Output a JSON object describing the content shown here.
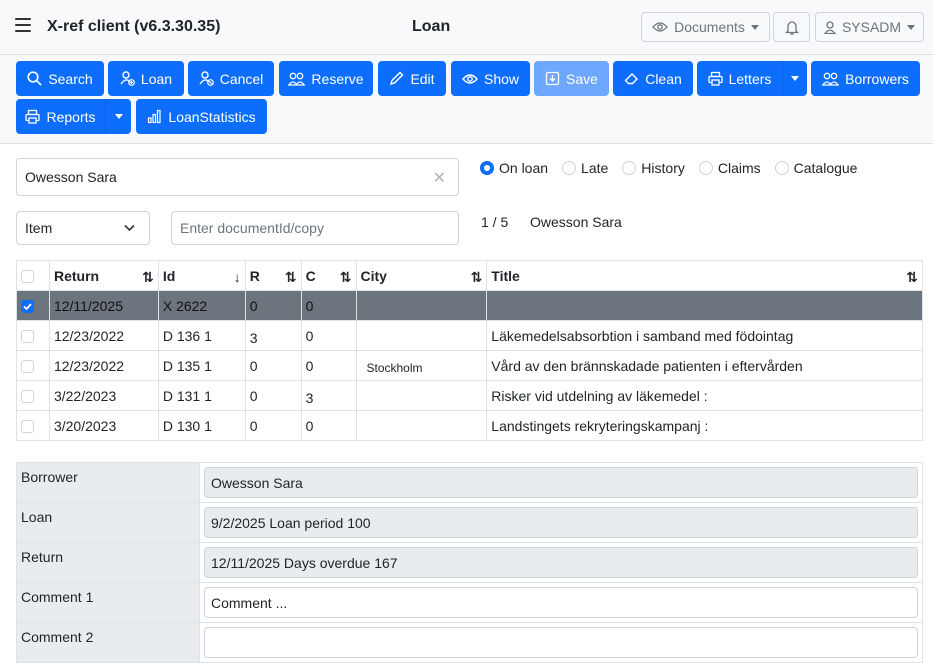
{
  "header": {
    "app_title": "X-ref client (v6.3.30.35)",
    "page_title": "Loan",
    "documents_label": "Documents",
    "user_label": "SYSADM"
  },
  "toolbar": {
    "search": "Search",
    "loan": "Loan",
    "cancel": "Cancel",
    "reserve": "Reserve",
    "edit": "Edit",
    "show": "Show",
    "save": "Save",
    "clean": "Clean",
    "letters": "Letters",
    "borrowers": "Borrowers",
    "reports": "Reports",
    "loanstatistics": "LoanStatistics"
  },
  "search": {
    "borrower_value": "Owesson Sara",
    "type_select": "Item",
    "doc_placeholder": "Enter documentId/copy"
  },
  "filters": {
    "options": [
      "On loan",
      "Late",
      "History",
      "Claims",
      "Catalogue"
    ],
    "selected": "On loan"
  },
  "pager": {
    "position": "1 / 5",
    "name": "Owesson Sara"
  },
  "table": {
    "headers": [
      "Return",
      "Id",
      "R",
      "C",
      "City",
      "Title"
    ],
    "rows": [
      {
        "return": "12/11/2025",
        "id": "X 2622",
        "r": "0",
        "c": "0",
        "city": "",
        "title": "",
        "selected": true
      },
      {
        "return": "12/23/2022",
        "id": "D 136 1",
        "r": "3",
        "c": "0",
        "city": "",
        "title": "Läkemedelsabsorbtion i samband med födointag",
        "selected": false
      },
      {
        "return": "12/23/2022",
        "id": "D 135 1",
        "r": "0",
        "c": "0",
        "city": "Stockholm",
        "title": "Vård av den brännskadade patienten i eftervården",
        "selected": false
      },
      {
        "return": "3/22/2023",
        "id": "D 131 1",
        "r": "0",
        "c": "3",
        "city": "",
        "title": "Risker vid utdelning av läkemedel :",
        "selected": false
      },
      {
        "return": "3/20/2023",
        "id": "D 130 1",
        "r": "0",
        "c": "0",
        "city": "",
        "title": "Landstingets rekryteringskampanj :",
        "selected": false
      }
    ]
  },
  "detail": {
    "borrower_label": "Borrower",
    "borrower_value": "Owesson Sara",
    "loan_label": "Loan",
    "loan_value": "9/2/2025  Loan period  100",
    "return_label": "Return",
    "return_value": "12/11/2025  Days overdue  167",
    "comment1_label": "Comment 1",
    "comment1_placeholder": "Comment ...",
    "comment2_label": "Comment 2",
    "comment2_value": ""
  },
  "colors": {
    "primary": "#0d6efd",
    "primary_disabled": "#6ea8fe",
    "selected_row": "#6c757d"
  }
}
